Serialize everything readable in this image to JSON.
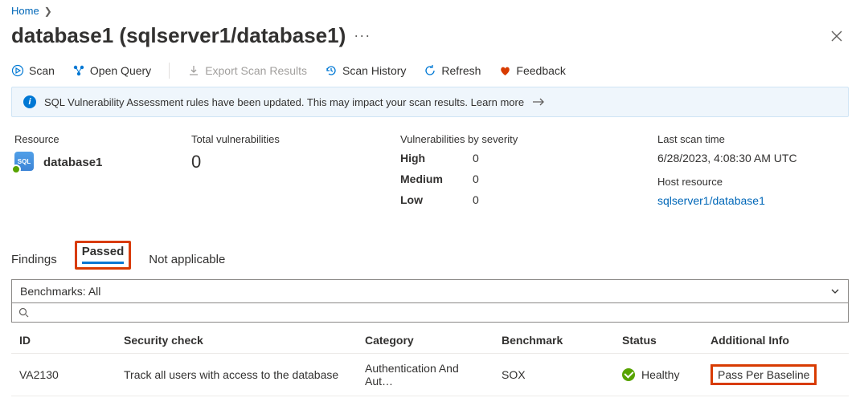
{
  "breadcrumb": {
    "home": "Home"
  },
  "page": {
    "title": "database1 (sqlserver1/database1)"
  },
  "toolbar": {
    "scan": "Scan",
    "open_query": "Open Query",
    "export": "Export Scan Results",
    "history": "Scan History",
    "refresh": "Refresh",
    "feedback": "Feedback"
  },
  "info_bar": {
    "text": "SQL Vulnerability Assessment rules have been updated. This may impact your scan results. Learn more"
  },
  "stats": {
    "resource_label": "Resource",
    "resource_name": "database1",
    "total_label": "Total vulnerabilities",
    "total_value": "0",
    "severity_label": "Vulnerabilities by severity",
    "high_label": "High",
    "high_value": "0",
    "medium_label": "Medium",
    "medium_value": "0",
    "low_label": "Low",
    "low_value": "0",
    "last_scan_label": "Last scan time",
    "last_scan_value": "6/28/2023, 4:08:30 AM UTC",
    "host_label": "Host resource",
    "host_value": "sqlserver1/database1"
  },
  "tabs": {
    "findings": "Findings",
    "passed": "Passed",
    "not_applicable": "Not applicable"
  },
  "filters": {
    "benchmarks": "Benchmarks: All"
  },
  "table": {
    "h_id": "ID",
    "h_check": "Security check",
    "h_category": "Category",
    "h_benchmark": "Benchmark",
    "h_status": "Status",
    "h_info": "Additional Info",
    "rows": [
      {
        "id": "VA2130",
        "check": "Track all users with access to the database",
        "category": "Authentication And Aut…",
        "benchmark": "SOX",
        "status": "Healthy",
        "info": "Pass Per Baseline"
      }
    ]
  }
}
